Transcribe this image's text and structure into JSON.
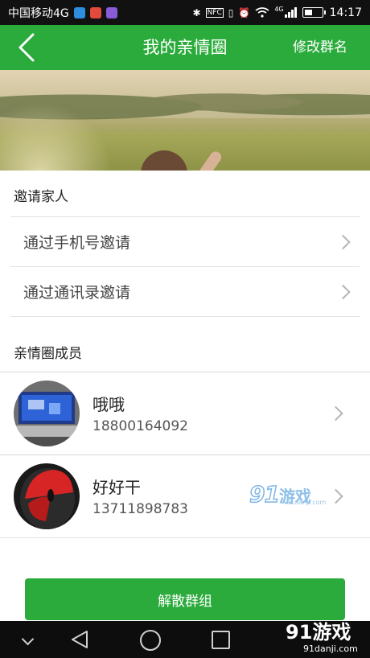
{
  "status_bar": {
    "carrier": "中国移动4G",
    "network": "4G",
    "nfc": "NFC",
    "time": "14:17",
    "icons": [
      "app-icon-blue",
      "app-icon-red",
      "app-icon-purple",
      "bluetooth-icon",
      "nfc-icon",
      "vibrate-icon",
      "alarm-icon",
      "wifi-icon",
      "signal-icon",
      "battery-icon"
    ]
  },
  "header": {
    "title": "我的亲情圈",
    "action_label": "修改群名",
    "back_icon": "chevron-left-icon",
    "background_color": "#2aab3b"
  },
  "invite_section": {
    "title": "邀请家人",
    "items": [
      {
        "label": "通过手机号邀请"
      },
      {
        "label": "通过通讯录邀请"
      }
    ]
  },
  "members_section": {
    "title": "亲情圈成员",
    "members": [
      {
        "name": "哦哦",
        "phone": "18800164092",
        "avatar": "laptop-photo"
      },
      {
        "name": "好好干",
        "phone": "13711898783",
        "avatar": "red-mouse-photo"
      }
    ]
  },
  "dissolve_button": {
    "label": "解散群组",
    "color": "#2aab3b"
  },
  "watermark": {
    "brand_number": "91",
    "brand_text": "游戏",
    "url": "91danji.com"
  },
  "system_nav": [
    "down-icon",
    "back-icon",
    "home-icon",
    "recents-icon"
  ]
}
